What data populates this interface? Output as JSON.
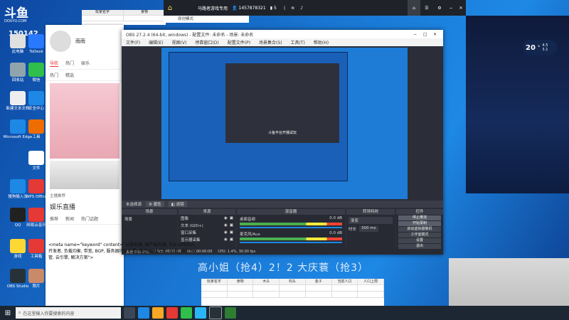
{
  "desktop": {
    "logo": "斗鱼",
    "logo_sub": "DOUYU.COM",
    "room_id": "150142",
    "icons": [
      {
        "label": "此电脑",
        "color": "#e0e0e0"
      },
      {
        "label": "ToDesk",
        "color": "#2979ff"
      },
      {
        "label": "回收站",
        "color": "#90a4ae"
      },
      {
        "label": "微信",
        "color": "#2fbf4a"
      },
      {
        "label": "新建文本文档",
        "color": "#eeeeee"
      },
      {
        "label": "安全中心",
        "color": "#1e88e5"
      },
      {
        "label": "Microsoft Edge",
        "color": "#1e88e5"
      },
      {
        "label": "工具",
        "color": "#ef6c00"
      },
      {
        "label": "文件",
        "color": "#ffffff"
      },
      {
        "label": "搜狗输入法",
        "color": "#1e88e5"
      },
      {
        "label": "WPS Office",
        "color": "#e53935"
      },
      {
        "label": "QQ",
        "color": "#212121"
      },
      {
        "label": "网易云音乐",
        "color": "#e53935"
      },
      {
        "label": "游戏",
        "color": "#fdd835"
      },
      {
        "label": "工具箱",
        "color": "#e53935"
      },
      {
        "label": "OBS Studio",
        "color": "#263238"
      },
      {
        "label": "照片",
        "color": "#c98a6a"
      }
    ]
  },
  "top_sheet": {
    "cols": [
      "玩家名字",
      "食物"
    ],
    "row": [
      "",
      ""
    ]
  },
  "assistant": {
    "title": "马路者游戏专用",
    "phone": "1457878321",
    "count": "5",
    "sub_label": "原创模式"
  },
  "chat": {
    "name": "雨雨",
    "tabs": [
      "导航",
      "热门",
      "娱乐"
    ],
    "sub_tabs": [
      "热门",
      "精选"
    ],
    "card_label": "主播推荐",
    "section": "娱乐直播",
    "sub2": [
      "推荐",
      "新闻",
      "热门话题"
    ]
  },
  "obs": {
    "title": "OBS 27.2.4 (64-bit, windows) - 配置文件: 未命名 - 场景: 未命名",
    "menu": [
      "文件(F)",
      "编辑(E)",
      "视图(V)",
      "停靠窗口(D)",
      "配置文件(P)",
      "场景集合(S)",
      "工具(T)",
      "帮助(H)"
    ],
    "preview_overlay": "斗鱼平台开播试玩",
    "source_label": "未选择源",
    "toolbar": [
      "属性",
      "滤镜"
    ],
    "docks": {
      "scenes": {
        "title": "场景",
        "items": [
          "场景"
        ]
      },
      "sources": {
        "title": "来源",
        "items": [
          "图像",
          "文本 (GDI+)",
          "窗口采集",
          "显示器采集"
        ]
      },
      "mixer": {
        "title": "混音器",
        "tracks": [
          "桌面音频",
          "麦克风/Aux"
        ],
        "level": "0.0 dB"
      },
      "transitions": {
        "title": "转场特效",
        "type": "渐变",
        "duration_label": "时长",
        "duration": "300 ms"
      },
      "controls": {
        "title": "控件",
        "buttons": [
          "停止推流",
          "开始录制",
          "启动虚拟摄像机",
          "工作室模式",
          "设置",
          "退出"
        ]
      }
    },
    "status": [
      "丢帧 0 (0.0%)",
      "LIVE: 00:00:00",
      "REC: 00:00:00",
      "CPU: 1.4%, 30.00 fps"
    ]
  },
  "meta_text": "<meta name=\"keyword\" content=\"云服务器, 国产服务器, SQLSERVER, 开发者, 负载均衡, 带宽, BGP, 服务器环境配置, 微信云, 云手机, 云盾, 应用托管, 云引擎, 解决方案\">",
  "overlay_text": "高小姐（抢4）2！2 大庆蓑（抢3）",
  "sheet": {
    "cols": [
      "玩家名字",
      "食物",
      "木头",
      "石头",
      "金子",
      "当前人口",
      "人口上限"
    ]
  },
  "weather": {
    "temp": "20",
    "unit": "°",
    "line1": "4.5",
    "line2": "3.1"
  },
  "taskbar": {
    "search_placeholder": "在这里输入你要搜索的内容"
  }
}
